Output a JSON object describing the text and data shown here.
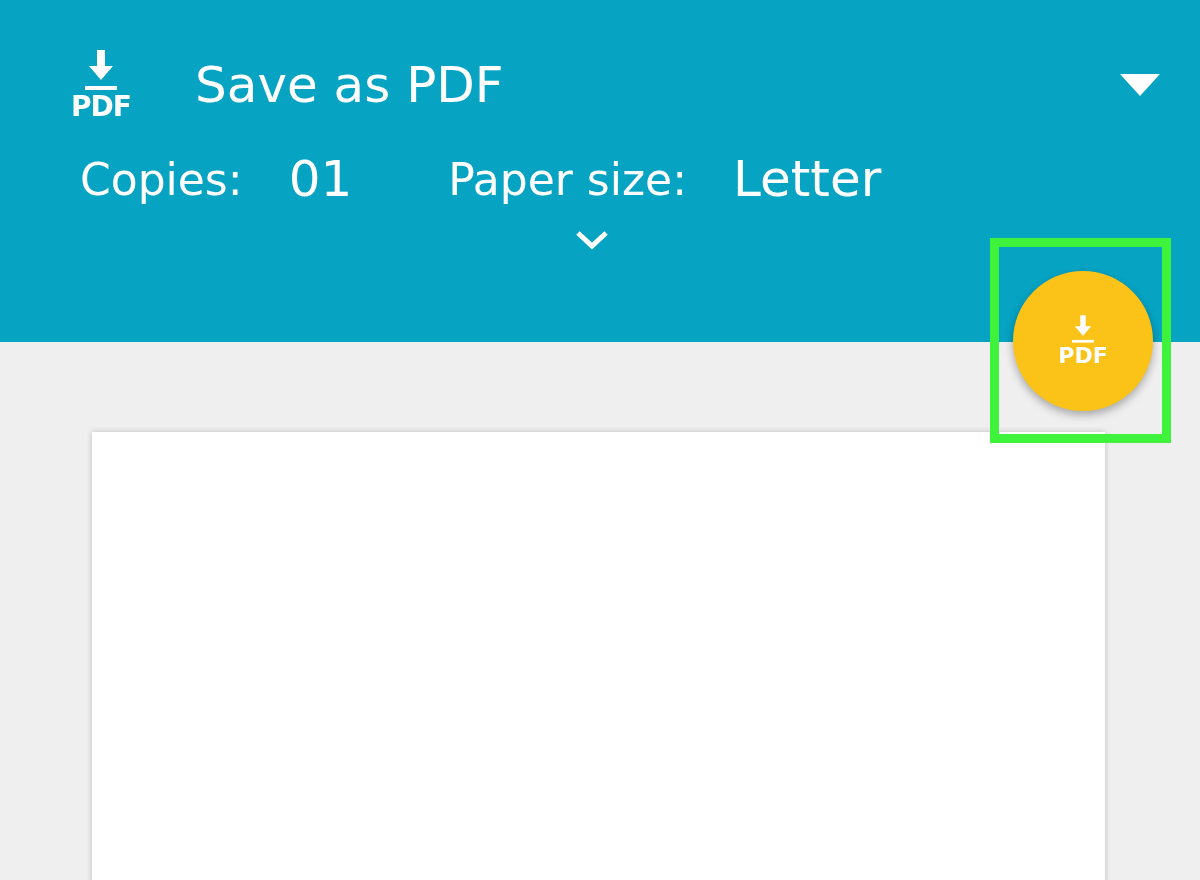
{
  "header": {
    "printer_icon_label": "PDF",
    "title": "Save as PDF",
    "copies_label": "Copies:",
    "copies_value": "01",
    "paper_size_label": "Paper size:",
    "paper_size_value": "Letter"
  },
  "fab": {
    "icon_label": "PDF",
    "highlighted": true
  },
  "preview": {
    "kind": "blank-page"
  }
}
